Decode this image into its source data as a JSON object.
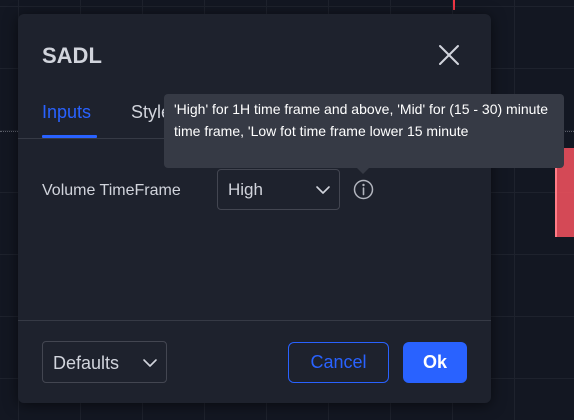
{
  "dialog": {
    "title": "SADL"
  },
  "tabs": [
    {
      "label": "Inputs",
      "active": true
    },
    {
      "label": "Style",
      "active": false
    }
  ],
  "inputs": {
    "volume_timeframe": {
      "label": "Volume TimeFrame",
      "value": "High"
    }
  },
  "tooltip": {
    "text": "'High' for 1H time frame and above, 'Mid' for (15 - 30) minute time frame, 'Low fot time frame lower 15 minute"
  },
  "footer": {
    "defaults_label": "Defaults",
    "cancel_label": "Cancel",
    "ok_label": "Ok"
  },
  "icons": {
    "close": "close-icon",
    "chevron": "chevron-down-icon",
    "info": "info-icon"
  },
  "colors": {
    "accent": "#2962ff",
    "dialog_bg": "#1e222d",
    "text": "#d1d4dc",
    "tooltip_bg": "#363a45",
    "chart_bg": "#131722"
  }
}
